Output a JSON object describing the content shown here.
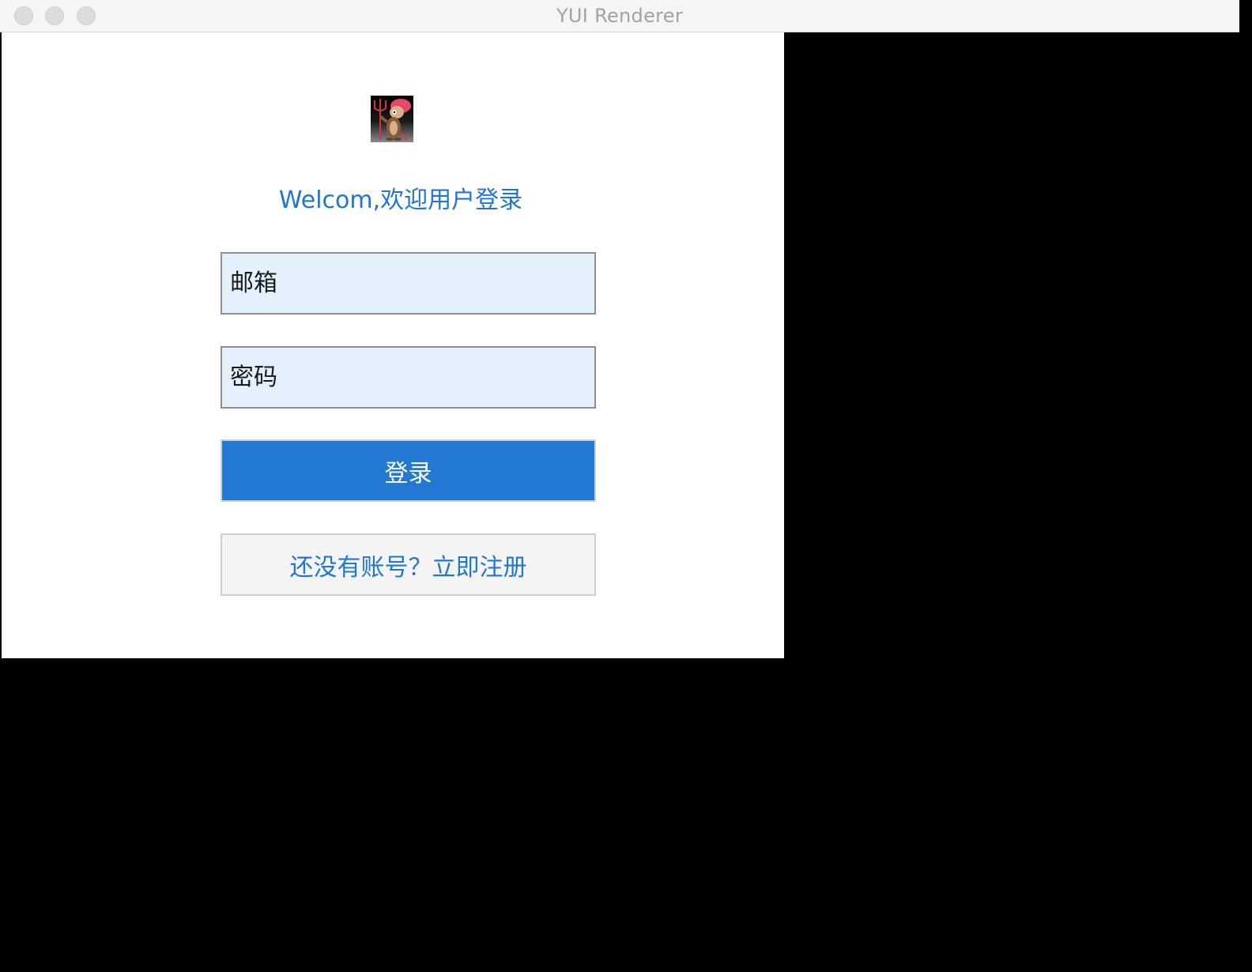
{
  "window": {
    "title": "YUI Renderer"
  },
  "login": {
    "logo_icon": "devil-cartoon-logo-icon",
    "welcome_text": "Welcom,欢迎用户登录",
    "email_placeholder": "邮箱",
    "password_placeholder": "密码",
    "login_button_label": "登录",
    "register_button_label": "还没有账号？立即注册"
  },
  "colors": {
    "accent": "#2176d0",
    "input_background": "#e3f1fc",
    "window_background": "#000000"
  }
}
